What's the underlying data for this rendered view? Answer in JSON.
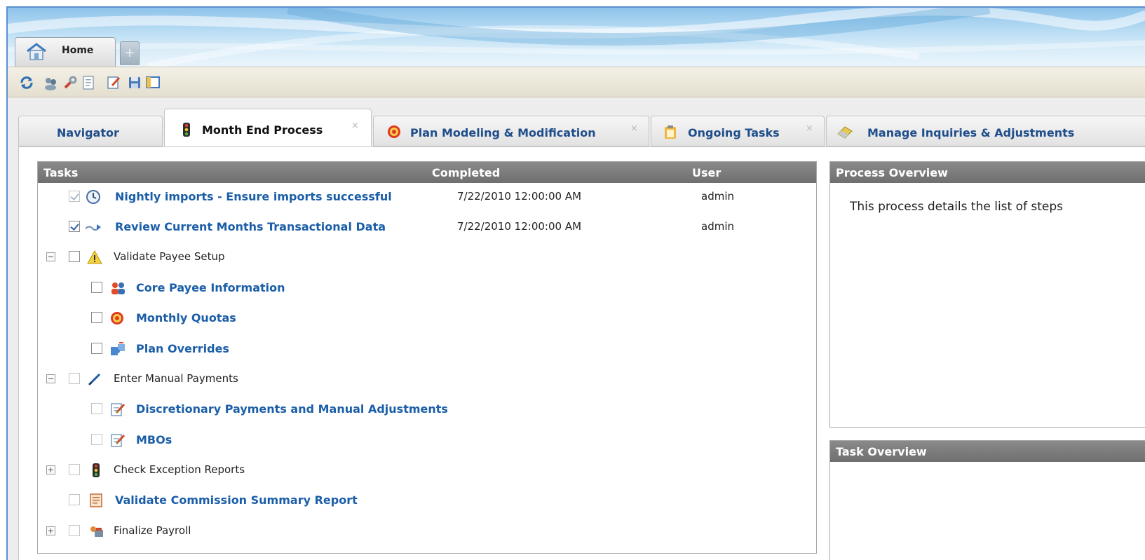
{
  "header": {
    "home_tab_label": "Home",
    "plus_label": "+"
  },
  "toolbar": {
    "icons": [
      "refresh-icon",
      "users-icon",
      "wrench-icon",
      "document-icon",
      "edit-icon",
      "save-icon",
      "window-icon"
    ]
  },
  "tabs": [
    {
      "label": "Navigator",
      "icon": "",
      "closable": false
    },
    {
      "label": "Month End Process",
      "icon": "traffic-light-icon",
      "closable": true,
      "active": true
    },
    {
      "label": "Plan Modeling & Modification",
      "icon": "target-icon",
      "closable": true
    },
    {
      "label": "Ongoing Tasks",
      "icon": "clipboard-icon",
      "closable": true
    },
    {
      "label": "Manage Inquiries & Adjustments",
      "icon": "eraser-icon",
      "closable": false
    }
  ],
  "close_glyph": "×",
  "tasks_panel": {
    "headers": {
      "tasks": "Tasks",
      "completed": "Completed",
      "user": "User"
    },
    "rows": [
      {
        "label": "Nightly imports - Ensure imports successful",
        "completed": "7/22/2010 12:00:00 AM",
        "user": "admin",
        "icon": "clock-icon"
      },
      {
        "label": "Review Current Months Transactional Data",
        "completed": "7/22/2010 12:00:00 AM",
        "user": "admin",
        "icon": "arrow-icon"
      },
      {
        "label": "Validate Payee Setup",
        "completed": "",
        "user": "",
        "icon": "warning-icon"
      },
      {
        "label": "Core Payee Information",
        "completed": "",
        "user": "",
        "icon": "people-icon"
      },
      {
        "label": "Monthly Quotas",
        "completed": "",
        "user": "",
        "icon": "target-icon"
      },
      {
        "label": "Plan Overrides",
        "completed": "",
        "user": "",
        "icon": "puzzle-icon"
      },
      {
        "label": "Enter Manual Payments",
        "completed": "",
        "user": "",
        "icon": "pen-icon"
      },
      {
        "label": "Discretionary Payments and Manual Adjustments",
        "completed": "",
        "user": "",
        "icon": "edit-doc-icon"
      },
      {
        "label": "MBOs",
        "completed": "",
        "user": "",
        "icon": "edit-doc-icon"
      },
      {
        "label": "Check Exception Reports",
        "completed": "",
        "user": "",
        "icon": "traffic-light-icon"
      },
      {
        "label": "Validate Commission Summary Report",
        "completed": "",
        "user": "",
        "icon": "report-icon"
      },
      {
        "label": "Finalize Payroll",
        "completed": "",
        "user": "",
        "icon": "payroll-icon"
      }
    ]
  },
  "process_overview": {
    "title": "Process Overview",
    "text": "This process details the list of steps"
  },
  "task_overview": {
    "title": "Task Overview"
  }
}
